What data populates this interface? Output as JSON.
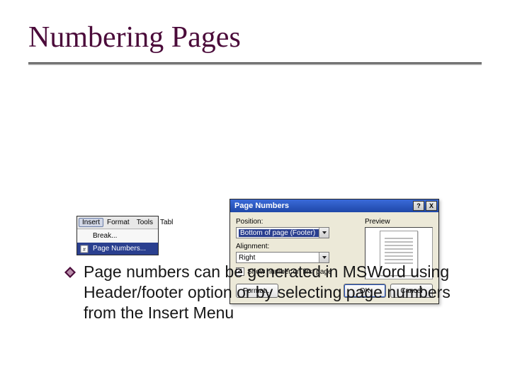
{
  "title": "Numbering Pages",
  "bullet_text": "Page numbers can be generated in MSWord using Header/footer option or by selecting page numbers from the Insert Menu",
  "menu": {
    "bar": {
      "insert": "Insert",
      "format": "Format",
      "tools": "Tools",
      "table": "Tabl"
    },
    "items": {
      "break": "Break...",
      "page_numbers": "Page Numbers..."
    }
  },
  "dialog": {
    "title": "Page Numbers",
    "help_btn": "?",
    "close_btn": "X",
    "position_label": "Position:",
    "position_value": "Bottom of page (Footer)",
    "alignment_label": "Alignment:",
    "alignment_value": "Right",
    "show_first_label": "Show number on first page",
    "show_first_checked": "✓",
    "preview_label": "Preview",
    "format_btn": "Format...",
    "ok_btn": "OK",
    "cancel_btn": "Cancel"
  }
}
